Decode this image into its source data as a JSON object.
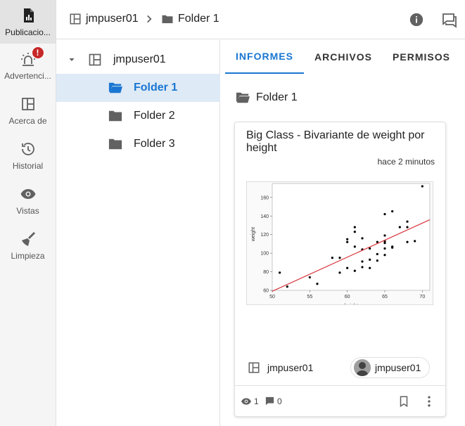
{
  "rail": {
    "items": [
      {
        "label": "Publicacio...",
        "icon": "report-icon",
        "active": true
      },
      {
        "label": "Advertenci...",
        "icon": "alarm-light-icon",
        "badge": "!"
      },
      {
        "label": "Acerca de",
        "icon": "dashboard-icon"
      },
      {
        "label": "Historial",
        "icon": "history-icon"
      },
      {
        "label": "Vistas",
        "icon": "eye-icon"
      },
      {
        "label": "Limpieza",
        "icon": "broom-icon"
      }
    ]
  },
  "breadcrumb": {
    "root": "jmpuser01",
    "current": "Folder 1"
  },
  "tree": {
    "root": "jmpuser01",
    "folders": [
      "Folder 1",
      "Folder 2",
      "Folder 3"
    ],
    "selected": "Folder 1"
  },
  "tabs": [
    "INFORMES",
    "ARCHIVOS",
    "PERMISOS"
  ],
  "active_tab": "INFORMES",
  "folder_title": "Folder 1",
  "card": {
    "title": "Big Class - Bivariante de weight por height",
    "time": "hace 2 minutos",
    "owner": "jmpuser01",
    "user_chip": "jmpuser01",
    "views": "1",
    "comments": "0"
  },
  "colors": {
    "accent": "#1976d2",
    "selected_bg": "#deeaf5",
    "badge": "#c62828",
    "fit_line": "#d9363e"
  },
  "chart_data": {
    "type": "scatter",
    "xlabel": "height",
    "ylabel": "weight",
    "xlim": [
      50,
      71
    ],
    "ylim": [
      60,
      175
    ],
    "xticks": [
      50,
      55,
      60,
      65,
      70
    ],
    "yticks": [
      60,
      80,
      100,
      120,
      140,
      160
    ],
    "points": [
      [
        51,
        79
      ],
      [
        52,
        64
      ],
      [
        55,
        74
      ],
      [
        56,
        67
      ],
      [
        58,
        95
      ],
      [
        59,
        79
      ],
      [
        59,
        95
      ],
      [
        60,
        84
      ],
      [
        60,
        112
      ],
      [
        60,
        115
      ],
      [
        61,
        81
      ],
      [
        61,
        107
      ],
      [
        61,
        123
      ],
      [
        61,
        128
      ],
      [
        62,
        85
      ],
      [
        62,
        91
      ],
      [
        62,
        104
      ],
      [
        62,
        116
      ],
      [
        63,
        84
      ],
      [
        63,
        93
      ],
      [
        63,
        105
      ],
      [
        64,
        92
      ],
      [
        64,
        99
      ],
      [
        64,
        112
      ],
      [
        65,
        98
      ],
      [
        65,
        105
      ],
      [
        65,
        111
      ],
      [
        65,
        113
      ],
      [
        65,
        119
      ],
      [
        65,
        142
      ],
      [
        66,
        106
      ],
      [
        66,
        107
      ],
      [
        66,
        145
      ],
      [
        67,
        128
      ],
      [
        68,
        112
      ],
      [
        68,
        128
      ],
      [
        68,
        134
      ],
      [
        69,
        113
      ],
      [
        70,
        172
      ]
    ],
    "fit_line": [
      [
        50,
        59
      ],
      [
        71,
        136
      ]
    ]
  }
}
